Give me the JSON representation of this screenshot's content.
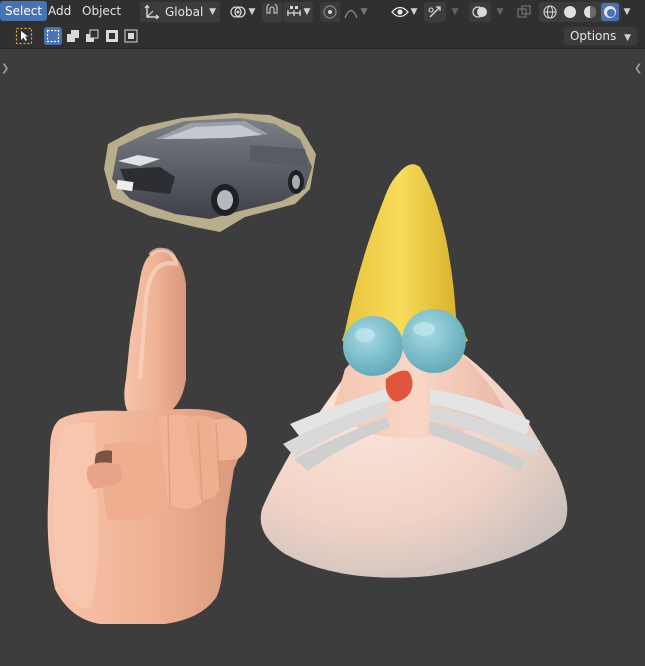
{
  "header": {
    "menus": [
      {
        "label": "Select",
        "active": true
      },
      {
        "label": "Add",
        "active": false
      },
      {
        "label": "Object",
        "active": false
      }
    ],
    "orientation_label": "Global",
    "options_label": "Options"
  },
  "icons": {
    "orientation": "transform-orientation-icon",
    "pivot": "pivot-point-icon",
    "snap": "snap-magnet-icon",
    "snap_target": "snap-increment-icon",
    "proportional": "proportional-editing-icon",
    "falloff": "falloff-curve-icon",
    "visibility": "eye-icon",
    "gizmo": "gizmo-icon",
    "overlays": "overlays-icon",
    "xray": "xray-icon",
    "shading": [
      "wireframe-icon",
      "solid-icon",
      "material-preview-icon",
      "rendered-icon"
    ]
  },
  "colors": {
    "header": "#303030",
    "viewport": "#3d3d3d",
    "accent": "#4772b3",
    "hat": "#f1d44f",
    "skin": "#f0b69b",
    "glasses": "#7ec2cf",
    "nose": "#e0563d",
    "beard": "#e2e2e2"
  }
}
